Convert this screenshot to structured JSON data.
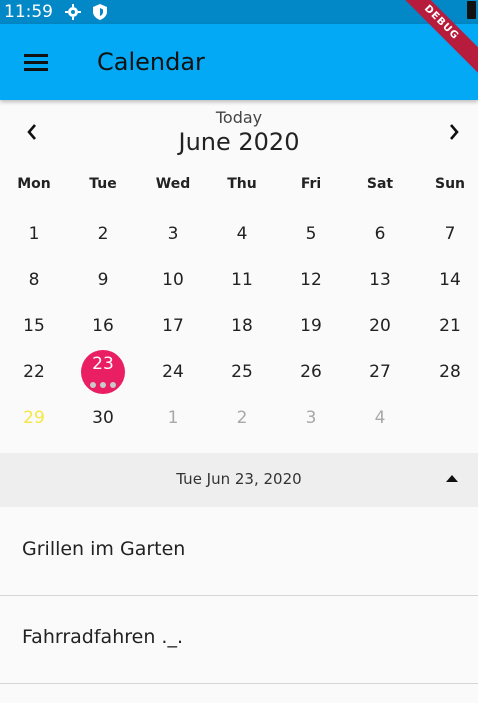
{
  "status_bar": {
    "time": "11:59",
    "icons": [
      "settings-icon",
      "shield-icon",
      "battery-icon"
    ]
  },
  "app_bar": {
    "title": "Calendar",
    "menu_icon": "menu-icon",
    "debug_banner": "DEBUG"
  },
  "calendar": {
    "today_label": "Today",
    "month_label": "June 2020",
    "prev_icon": "chevron-left-icon",
    "next_icon": "chevron-right-icon",
    "weekdays": [
      "Mon",
      "Tue",
      "Wed",
      "Thu",
      "Fri",
      "Sat",
      "Sun"
    ],
    "weeks": [
      [
        {
          "d": "1"
        },
        {
          "d": "2"
        },
        {
          "d": "3"
        },
        {
          "d": "4"
        },
        {
          "d": "5"
        },
        {
          "d": "6"
        },
        {
          "d": "7"
        }
      ],
      [
        {
          "d": "8"
        },
        {
          "d": "9"
        },
        {
          "d": "10"
        },
        {
          "d": "11"
        },
        {
          "d": "12"
        },
        {
          "d": "13"
        },
        {
          "d": "14"
        }
      ],
      [
        {
          "d": "15"
        },
        {
          "d": "16"
        },
        {
          "d": "17"
        },
        {
          "d": "18"
        },
        {
          "d": "19"
        },
        {
          "d": "20"
        },
        {
          "d": "21"
        }
      ],
      [
        {
          "d": "22"
        },
        {
          "d": "23",
          "selected": true,
          "events": 3
        },
        {
          "d": "24"
        },
        {
          "d": "25"
        },
        {
          "d": "26"
        },
        {
          "d": "27"
        },
        {
          "d": "28"
        }
      ],
      [
        {
          "d": "29",
          "state": "weekend-out"
        },
        {
          "d": "30"
        },
        {
          "d": "1",
          "state": "outside"
        },
        {
          "d": "2",
          "state": "outside"
        },
        {
          "d": "3",
          "state": "outside"
        },
        {
          "d": "4",
          "state": "outside"
        }
      ]
    ],
    "selected_color": "#e91e63"
  },
  "selected_date_bar": {
    "label": "Tue Jun 23, 2020",
    "collapse_icon": "triangle-up-icon"
  },
  "events": [
    {
      "title": "Grillen im Garten"
    },
    {
      "title": "Fahrradfahren ._."
    }
  ],
  "colors": {
    "app_bar": "#03a9f4",
    "status_bar": "#0288c7",
    "outside_day": "#a8a8a8",
    "highlight_day": "#f5e642"
  }
}
